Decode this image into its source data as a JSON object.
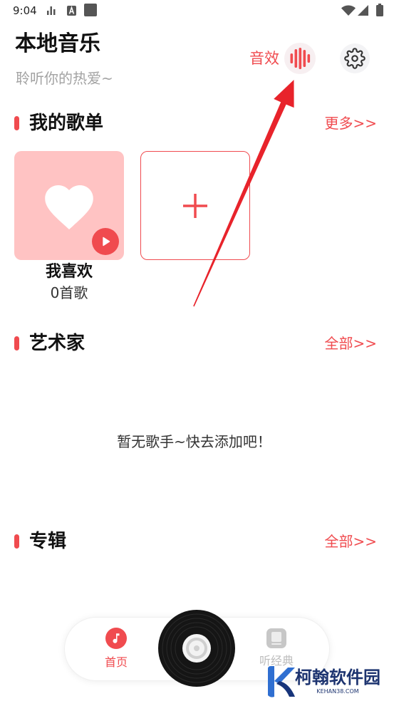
{
  "status_bar": {
    "time": "9:04",
    "left_icons": [
      "data-icon",
      "app-a-icon",
      "square-app-icon"
    ],
    "right_icons": [
      "wifi-icon",
      "signal-icon",
      "battery-icon"
    ]
  },
  "header": {
    "title": "本地音乐",
    "subtitle": "聆听你的热爱~",
    "sound_effect": {
      "label": "音效",
      "icon": "sound-wave-icon"
    },
    "settings": {
      "icon": "gear-icon"
    }
  },
  "playlists_section": {
    "title": "我的歌单",
    "more_label": "更多>>",
    "items": [
      {
        "name": "我喜欢",
        "song_count": "0首歌",
        "cover_icon": "heart-icon",
        "action_icon": "play-icon"
      }
    ],
    "add_card": {
      "icon": "plus-icon"
    }
  },
  "artists_section": {
    "title": "艺术家",
    "more_label": "全部>>",
    "empty_text": "暂无歌手~快去添加吧！"
  },
  "albums_section": {
    "title": "专辑",
    "more_label": "全部>>"
  },
  "bottom_nav": {
    "tabs": [
      {
        "label": "首页",
        "icon": "music-note-icon",
        "active": true
      },
      {
        "label": "听经典",
        "icon": "book-icon",
        "active": false
      }
    ],
    "center_button": {
      "icon": "vinyl-disc-icon"
    }
  },
  "watermark": {
    "name": "柯翰软件园",
    "site": "KEHAN38.COM",
    "logo_icon": "k-logo-icon"
  },
  "colors": {
    "accent": "#f04b4f",
    "cover_pink": "#ffc3c3",
    "text_primary": "#1f1f1f",
    "text_muted": "#a3a3a3",
    "tab_inactive": "#bdbdbd",
    "watermark_blue": "#1d3470",
    "arrow_annotation": "#e8232b"
  }
}
